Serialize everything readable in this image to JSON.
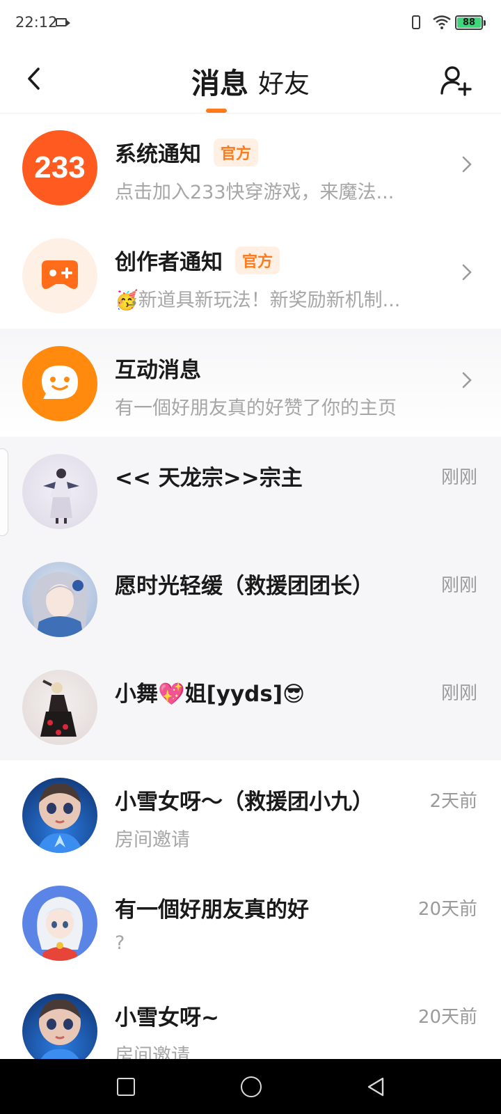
{
  "status_bar": {
    "time": "22:12",
    "battery": "88"
  },
  "header": {
    "tabs": [
      {
        "label": "消息"
      },
      {
        "label": "好友"
      }
    ]
  },
  "notifications": [
    {
      "avatar_text": "233",
      "title": "系统通知",
      "badge": "官方",
      "subtitle": "点击加入233快穿游戏，来魔法..."
    },
    {
      "title": "创作者通知",
      "badge": "官方",
      "subtitle": "🥳新道具新玩法！新奖励新机制..."
    },
    {
      "title": "互动消息",
      "subtitle": "有一個好朋友真的好赞了你的主页"
    }
  ],
  "chats": [
    {
      "name": "<< 天龙宗>>宗主",
      "time": "刚刚",
      "preview": ""
    },
    {
      "name": "愿时光轻缓（救援团团长）",
      "time": "刚刚",
      "preview": ""
    },
    {
      "name": "小舞💖姐[yyds]😎",
      "time": "刚刚",
      "preview": ""
    },
    {
      "name": "小雪女呀～（救援团小九）",
      "time": "2天前",
      "preview": "房间邀请"
    },
    {
      "name": "有一個好朋友真的好",
      "time": "20天前",
      "preview": "?"
    },
    {
      "name": "小雪女呀~",
      "time": "20天前",
      "preview": "房间邀请"
    }
  ],
  "colors": {
    "accent": "#ff7a1a",
    "badge_bg": "#fff0e3",
    "battery": "#3ed67a"
  }
}
